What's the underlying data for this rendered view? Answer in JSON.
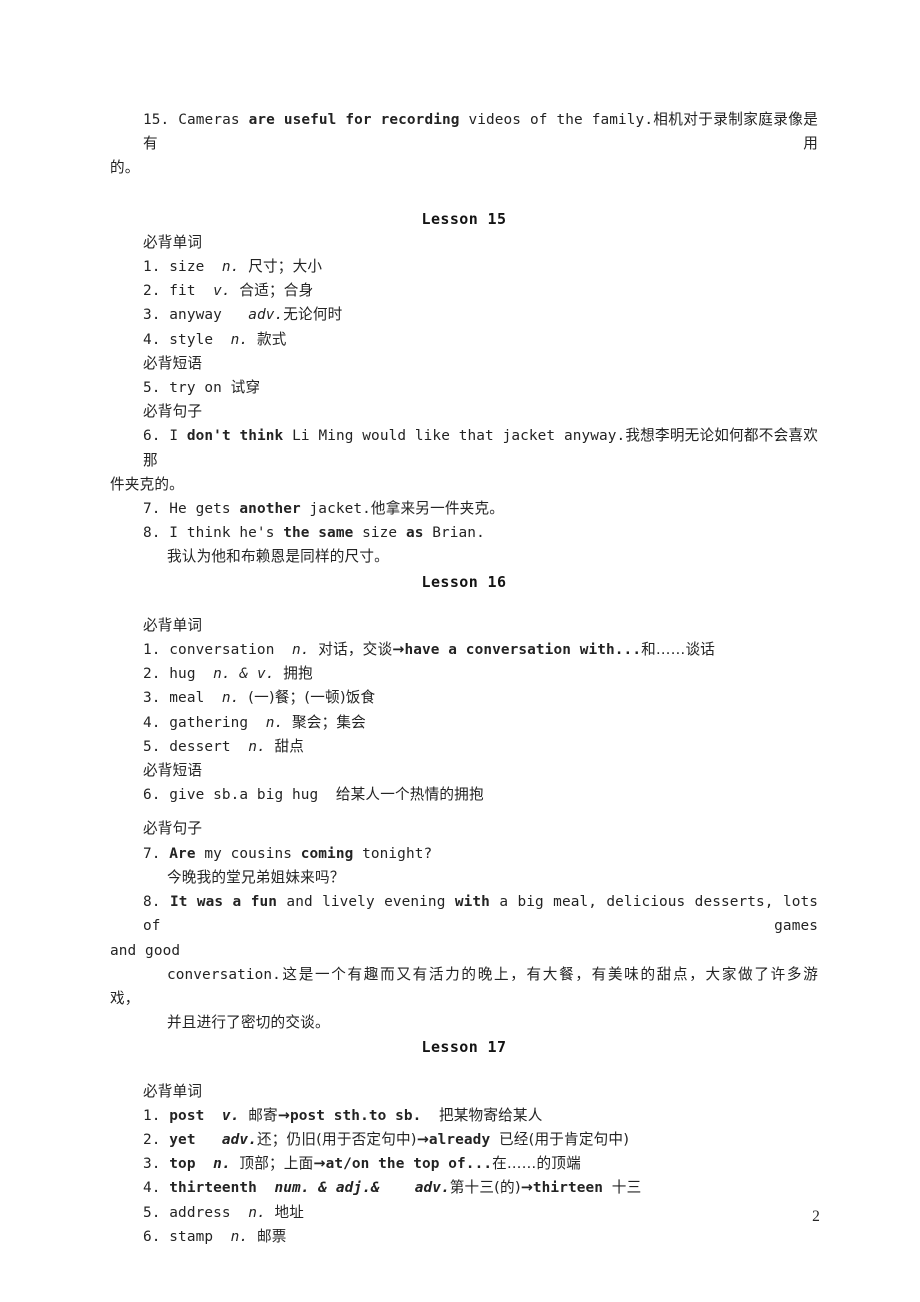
{
  "document": {
    "page_number": "2",
    "top_entry": {
      "number": "15.",
      "text_en_1": "Cameras ",
      "text_en_bold": "are useful for recording",
      "text_en_2": " videos of the family.",
      "text_cn": "相机对于录制家庭录像是有用",
      "text_cn_wrap": "的。"
    },
    "lessons": [
      {
        "title": "Lesson 15",
        "sections": [
          {
            "heading": "必背单词",
            "items": [
              {
                "num": "1.",
                "word": "size",
                "pos": "n.",
                "meaning": "尺寸；大小"
              },
              {
                "num": "2.",
                "word": "fit",
                "pos": "v.",
                "meaning": "合适；合身"
              },
              {
                "num": "3.",
                "word": "anyway",
                "pos": "adv.",
                "meaning": "无论何时"
              },
              {
                "num": "4.",
                "word": "style",
                "pos": "n.",
                "meaning": "款式"
              }
            ]
          },
          {
            "heading": "必背短语",
            "items": [
              {
                "num": "5.",
                "word": "try on",
                "pos": "",
                "meaning": "试穿"
              }
            ]
          },
          {
            "heading": "必背句子",
            "sentences": [
              {
                "num": "6.",
                "parts": [
                  {
                    "t": "I ",
                    "bold": false
                  },
                  {
                    "t": "don't think",
                    "bold": true
                  },
                  {
                    "t": " Li Ming would like that jacket anyway.",
                    "bold": false
                  }
                ],
                "cn": "我想李明无论如何都不会喜欢那",
                "cn_wrap": "件夹克的。"
              },
              {
                "num": "7.",
                "parts": [
                  {
                    "t": "He gets ",
                    "bold": false
                  },
                  {
                    "t": "another",
                    "bold": true
                  },
                  {
                    "t": " jacket.",
                    "bold": false
                  }
                ],
                "cn": "他拿来另一件夹克。",
                "cn_wrap": ""
              },
              {
                "num": "8.",
                "parts": [
                  {
                    "t": "I think he's ",
                    "bold": false
                  },
                  {
                    "t": "the same",
                    "bold": true
                  },
                  {
                    "t": " size ",
                    "bold": false
                  },
                  {
                    "t": "as",
                    "bold": true
                  },
                  {
                    "t": " Brian.",
                    "bold": false
                  }
                ],
                "cn": "",
                "cn_line": "我认为他和布赖恩是同样的尺寸。"
              }
            ]
          }
        ]
      },
      {
        "title": "Lesson 16",
        "sections": [
          {
            "heading": "必背单词",
            "items": [
              {
                "num": "1.",
                "word": "conversation",
                "pos": "n.",
                "meaning": "对话，交谈",
                "arrow": "→",
                "extra_en": "have a conversation with...",
                "extra_cn": "和……谈话"
              },
              {
                "num": "2.",
                "word": "hug",
                "pos": "n. & v.",
                "meaning": "拥抱"
              },
              {
                "num": "3.",
                "word": "meal",
                "pos": "n.",
                "meaning": "(一)餐；(一顿)饭食"
              },
              {
                "num": "4.",
                "word": "gathering",
                "pos": "n.",
                "meaning": "聚会；集会"
              },
              {
                "num": "5.",
                "word": "dessert",
                "pos": "n.",
                "meaning": "甜点"
              }
            ]
          },
          {
            "heading": "必背短语",
            "items": [
              {
                "num": "6.",
                "word": "give sb.a big hug",
                "pos": "",
                "meaning": "给某人一个热情的拥抱"
              }
            ]
          },
          {
            "heading": "必背句子",
            "sentences": [
              {
                "num": "7.",
                "parts": [
                  {
                    "t": "Are",
                    "bold": true
                  },
                  {
                    "t": " my cousins ",
                    "bold": false
                  },
                  {
                    "t": "coming",
                    "bold": true
                  },
                  {
                    "t": " tonight?",
                    "bold": false
                  }
                ],
                "cn_line": "今晚我的堂兄弟姐妹来吗？"
              },
              {
                "num": "8.",
                "parts": [
                  {
                    "t": "It was a fun",
                    "bold": true
                  },
                  {
                    "t": " and lively evening ",
                    "bold": false
                  },
                  {
                    "t": "with",
                    "bold": true
                  },
                  {
                    "t": " a big meal, delicious desserts, lots of games",
                    "bold": false
                  }
                ],
                "wrap_en": "and good",
                "cont_en": "conversation.",
                "cont_cn": "这是一个有趣而又有活力的晚上，有大餐，有美味的甜点，大家做了许多游",
                "cont_cn_wrap": "戏，",
                "cont_cn_last": "并且进行了密切的交谈。"
              }
            ]
          }
        ]
      },
      {
        "title": "Lesson 17",
        "sections": [
          {
            "heading": "必背单词",
            "items": [
              {
                "num": "1.",
                "word": "post",
                "pos": "v.",
                "meaning": "邮寄",
                "arrow": "→",
                "extra_en": "post sth.to sb.",
                "extra_cn": "把某物寄给某人"
              },
              {
                "num": "2.",
                "word": "yet",
                "pos": "adv.",
                "meaning": "还；仍旧(用于否定句中)",
                "arrow": "→",
                "extra_en": "already",
                "extra_cn": "已经(用于肯定句中)"
              },
              {
                "num": "3.",
                "word": "top",
                "pos": "n.",
                "meaning": "顶部；上面",
                "arrow": "→",
                "extra_en": "at/on the top of...",
                "extra_cn": "在……的顶端"
              },
              {
                "num": "4.",
                "word": "thirteenth",
                "pos": "num. & adj.&",
                "pos2": "adv.",
                "meaning": "第十三(的)",
                "arrow": "→",
                "extra_en": "thirteen",
                "extra_cn": "十三"
              },
              {
                "num": "5.",
                "word": "address",
                "pos": "n.",
                "meaning": "地址"
              },
              {
                "num": "6.",
                "word": "stamp",
                "pos": "n.",
                "meaning": "邮票"
              }
            ]
          }
        ]
      }
    ]
  }
}
